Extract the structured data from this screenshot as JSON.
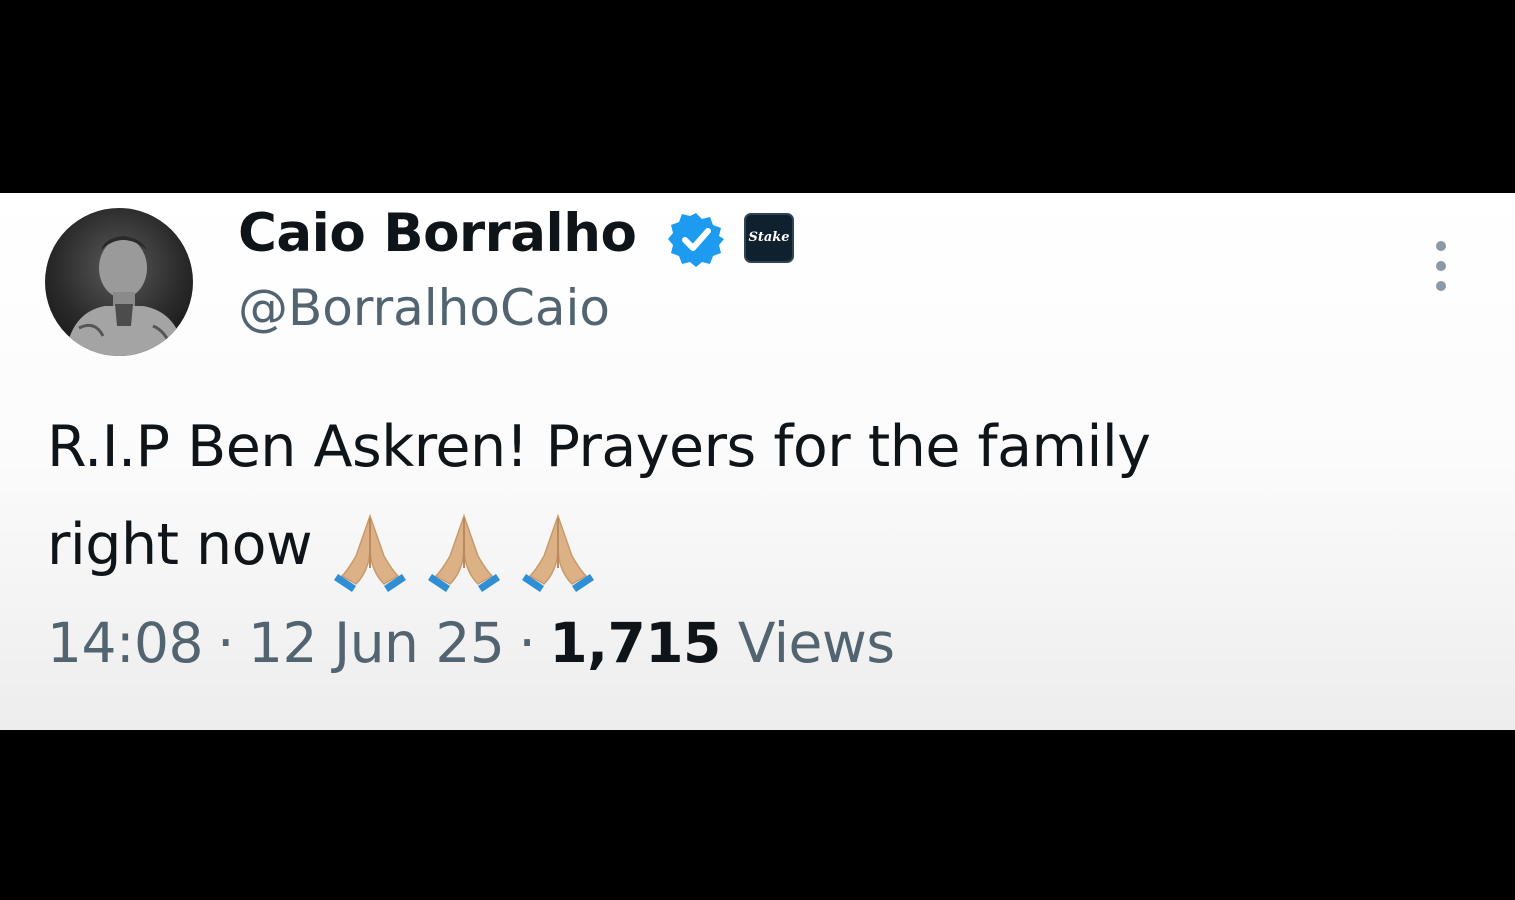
{
  "tweet": {
    "author": {
      "display_name": "Caio Borralho",
      "handle": "@BorralhoCaio",
      "verified": true,
      "verified_color": "#1d9bf0",
      "affiliate_badge_text": "Stake",
      "avatar_icon": "profile-photo"
    },
    "text_line1": "R.I.P Ben Askren! Prayers for the family",
    "text_line2": "right now",
    "emojis": [
      "🙏🏼",
      "🙏🏼",
      "🙏🏼"
    ],
    "time": "14:08",
    "date": "12 Jun 25",
    "separator": "·",
    "views_count": "1,715",
    "views_label": "Views",
    "more_icon": "more-vertical-icon"
  }
}
